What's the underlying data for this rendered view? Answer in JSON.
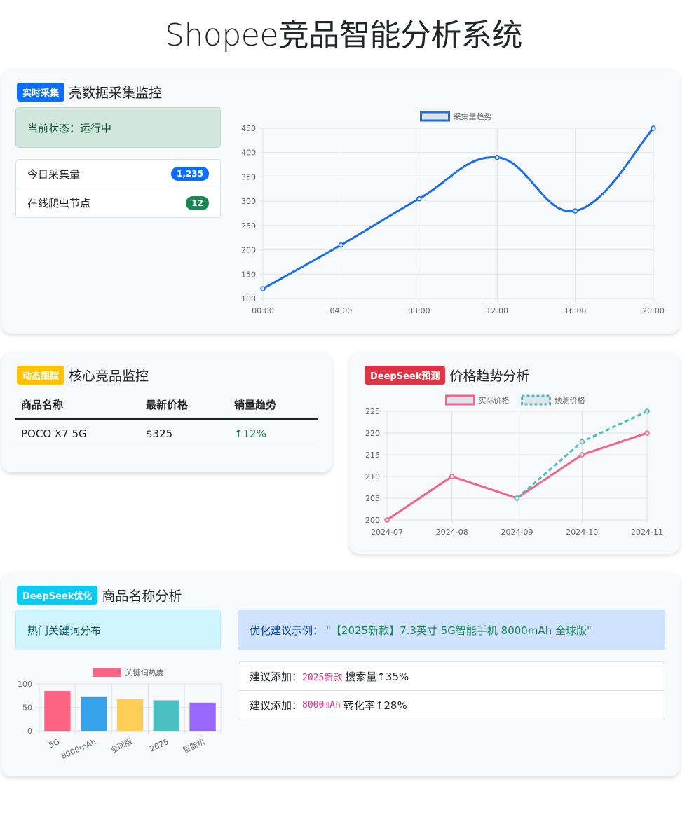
{
  "page": {
    "title": "Shopee竞品智能分析系统"
  },
  "colors": {
    "primary": "#0d6efd",
    "success": "#198754",
    "warning": "#ffc107",
    "danger": "#dc3545",
    "info": "#0dcaf0",
    "line_blue": "#1a6fe8",
    "line_pink": "#f0648a",
    "line_teal": "#4bbfc0"
  },
  "collect": {
    "badge": "实时采集",
    "title": "亮数据采集监控",
    "status_text": "当前状态：运行中",
    "stats": [
      {
        "label": "今日采集量",
        "value": "1,235",
        "color": "#0d6efd"
      },
      {
        "label": "在线爬虫节点",
        "value": "12",
        "color": "#198754"
      }
    ]
  },
  "track": {
    "badge": "动态跟踪",
    "title": "核心竞品监控",
    "columns": [
      "商品名称",
      "最新价格",
      "销量趋势"
    ],
    "rows": [
      {
        "name": "POCO X7 5G",
        "price": "$325",
        "trend": "↑12%"
      }
    ]
  },
  "price": {
    "badge": "DeepSeek预测",
    "title": "价格趋势分析"
  },
  "naming": {
    "badge": "DeepSeek优化",
    "title": "商品名称分析",
    "keyword_header": "热门关键词分布",
    "suggestion_prefix": "优化建议示例：",
    "suggestion_example": "\"【2025新款】7.3英寸 5G智能手机 8000mAh 全球版\"",
    "suggestions": [
      {
        "prefix": "建议添加：",
        "keyword": "2025新款",
        "effect": "搜索量↑35%"
      },
      {
        "prefix": "建议添加：",
        "keyword": "8000mAh",
        "effect": "转化率↑28%"
      }
    ]
  },
  "chart_data": [
    {
      "type": "line",
      "legend": [
        "采集量趋势"
      ],
      "x": [
        "00:00",
        "04:00",
        "08:00",
        "12:00",
        "16:00",
        "20:00"
      ],
      "series": [
        {
          "name": "采集量趋势",
          "values": [
            120,
            210,
            305,
            390,
            280,
            450
          ]
        }
      ],
      "ylim": [
        100,
        450
      ],
      "yticks": [
        100,
        150,
        200,
        250,
        300,
        350,
        400,
        450
      ],
      "grid": true,
      "legend_position": "top"
    },
    {
      "type": "line",
      "legend": [
        "实际价格",
        "预测价格"
      ],
      "x": [
        "2024-07",
        "2024-08",
        "2024-09",
        "2024-10",
        "2024-11"
      ],
      "series": [
        {
          "name": "实际价格",
          "values": [
            200,
            210,
            205,
            215,
            220
          ]
        },
        {
          "name": "预测价格",
          "values": [
            null,
            null,
            205,
            218,
            225
          ]
        }
      ],
      "ylim": [
        200,
        225
      ],
      "yticks": [
        200,
        205,
        210,
        215,
        220,
        225
      ],
      "grid": true,
      "legend_position": "top"
    },
    {
      "type": "bar",
      "legend": [
        "关键词热度"
      ],
      "categories": [
        "5G",
        "8000mAh",
        "全球版",
        "2025",
        "智能机"
      ],
      "values": [
        85,
        72,
        68,
        65,
        60
      ],
      "bar_colors": [
        "#ff6384",
        "#36a2eb",
        "#ffce56",
        "#4bc0c0",
        "#9966ff"
      ],
      "ylim": [
        0,
        100
      ],
      "yticks": [
        0,
        50,
        100
      ],
      "grid": true,
      "legend_position": "top"
    }
  ]
}
